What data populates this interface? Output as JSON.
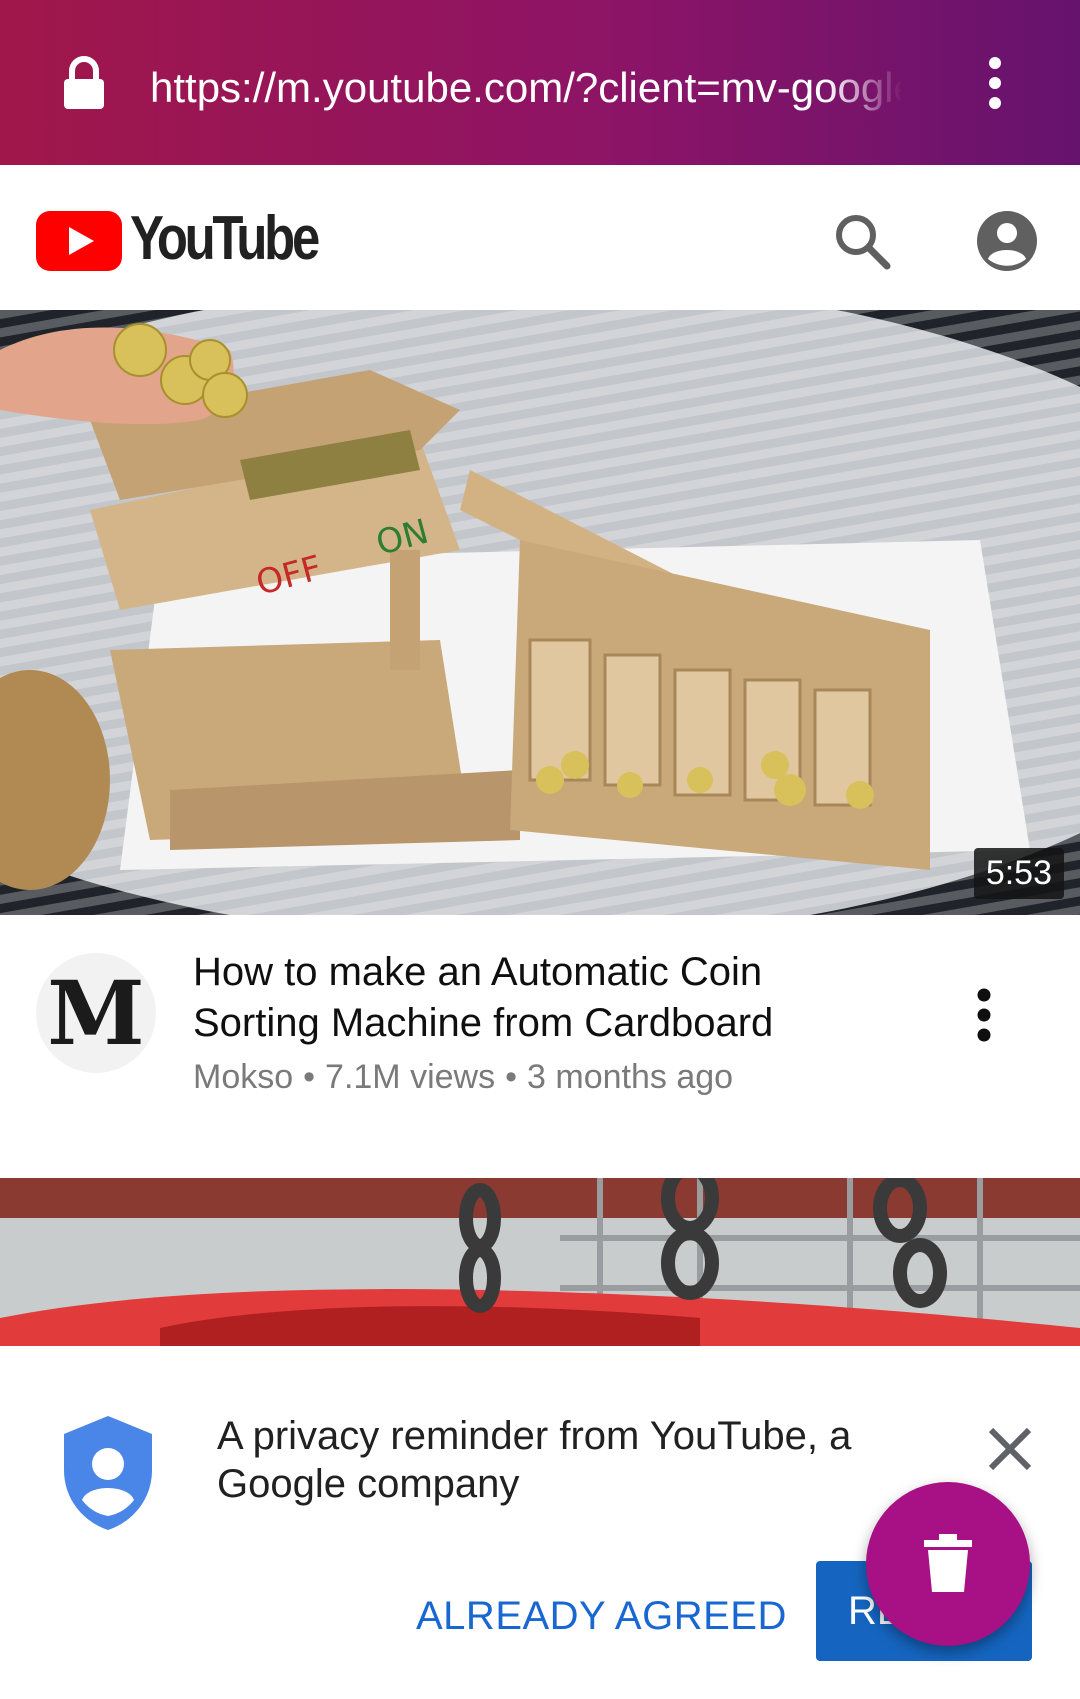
{
  "browser": {
    "url": "https://m.youtube.com/?client=mv-google",
    "lock_icon": "lock-icon",
    "menu_icon": "more-vert-icon"
  },
  "header": {
    "logo_text": "YouTube",
    "icons": [
      "youtube-play-logo-icon",
      "search-icon",
      "account-circle-icon"
    ]
  },
  "videos": [
    {
      "duration": "5:53",
      "channel_avatar_letter": "M",
      "title": "How to make an Automatic Coin Sorting Machine from Cardboard",
      "channel": "Mokso",
      "views": "7.1M views",
      "age": "3 months ago",
      "separator": "•"
    }
  ],
  "privacy": {
    "message": "A privacy reminder from YouTube, a Google company",
    "already_agreed_label": "ALREADY AGREED",
    "review_label": "REVIEW"
  },
  "colors": {
    "browser_bar_start": "#a0174a",
    "browser_bar_end": "#66136e",
    "youtube_red": "#ff0000",
    "link_blue": "#1967d2",
    "button_blue": "#1565c0",
    "fab_magenta": "#a81085"
  }
}
